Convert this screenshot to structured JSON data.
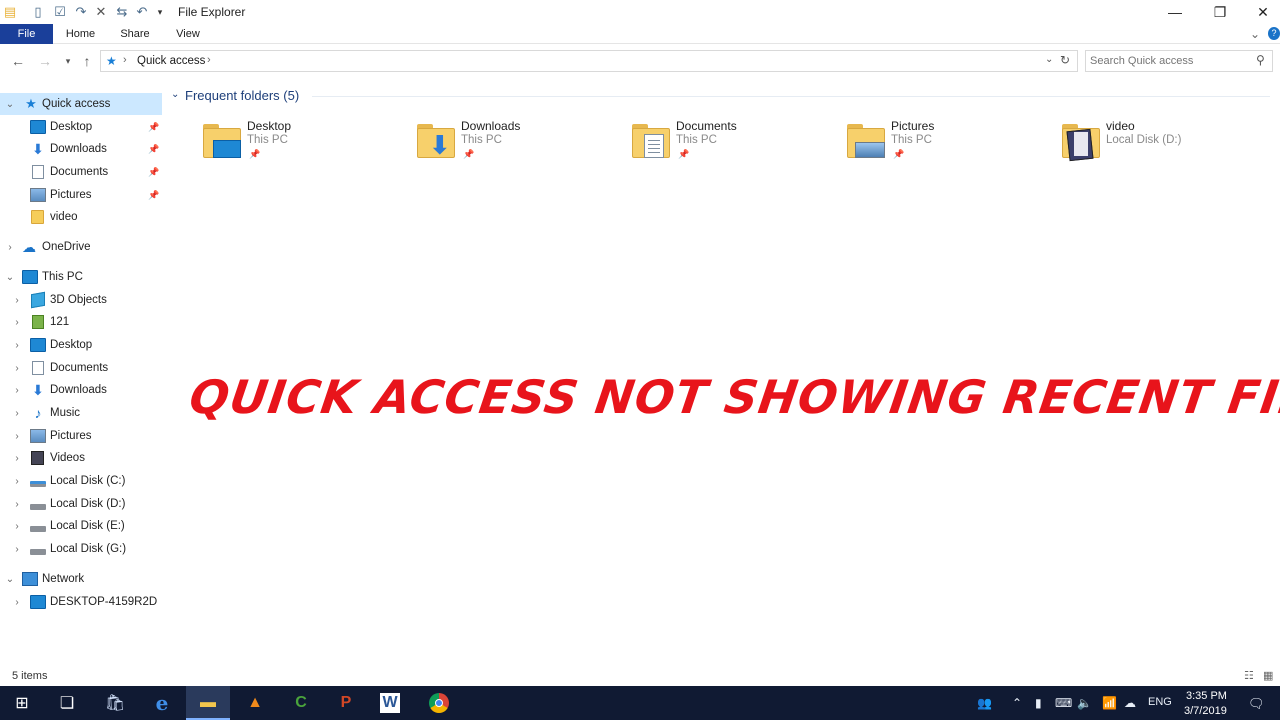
{
  "window": {
    "title": "File Explorer",
    "controls": {
      "minimize": "—",
      "restore": "❐",
      "close": "✕"
    }
  },
  "ribbon": {
    "tabs": [
      "File",
      "Home",
      "Share",
      "View"
    ],
    "expand_icon": "⌄",
    "help_icon": "?"
  },
  "address": {
    "path_icon": "quick-access-star",
    "path": "Quick access",
    "separator": "›",
    "search_placeholder": "Search Quick access"
  },
  "nav": {
    "quick_access": {
      "label": "Quick access",
      "items": [
        {
          "label": "Desktop",
          "icon": "desktop-icon",
          "pinned": true
        },
        {
          "label": "Downloads",
          "icon": "downloads-icon",
          "pinned": true
        },
        {
          "label": "Documents",
          "icon": "documents-icon",
          "pinned": true
        },
        {
          "label": "Pictures",
          "icon": "pictures-icon",
          "pinned": true
        },
        {
          "label": "video",
          "icon": "folder-icon",
          "pinned": false
        }
      ]
    },
    "onedrive": {
      "label": "OneDrive"
    },
    "this_pc": {
      "label": "This PC",
      "items": [
        {
          "label": "3D Objects",
          "icon": "3d-objects-icon"
        },
        {
          "label": "121",
          "icon": "image-file-icon"
        },
        {
          "label": "Desktop",
          "icon": "desktop-icon"
        },
        {
          "label": "Documents",
          "icon": "documents-icon"
        },
        {
          "label": "Downloads",
          "icon": "downloads-icon"
        },
        {
          "label": "Music",
          "icon": "music-icon"
        },
        {
          "label": "Pictures",
          "icon": "pictures-icon"
        },
        {
          "label": "Videos",
          "icon": "videos-icon"
        },
        {
          "label": "Local Disk (C:)",
          "icon": "system-drive-icon"
        },
        {
          "label": "Local Disk (D:)",
          "icon": "drive-icon"
        },
        {
          "label": "Local Disk (E:)",
          "icon": "drive-icon"
        },
        {
          "label": "Local Disk (G:)",
          "icon": "drive-icon"
        }
      ]
    },
    "network": {
      "label": "Network",
      "items": [
        {
          "label": "DESKTOP-4159R2D",
          "icon": "computer-icon"
        }
      ]
    }
  },
  "content": {
    "group_header": "Frequent folders (5)",
    "folders": [
      {
        "name": "Desktop",
        "location": "This PC",
        "pinned": true
      },
      {
        "name": "Downloads",
        "location": "This PC",
        "pinned": true
      },
      {
        "name": "Documents",
        "location": "This PC",
        "pinned": true
      },
      {
        "name": "Pictures",
        "location": "This PC",
        "pinned": true
      },
      {
        "name": "video",
        "location": "Local Disk (D:)",
        "pinned": false
      }
    ]
  },
  "caption": "QUICK ACCESS NOT SHOWING RECENT FILES",
  "status": {
    "item_count": "5 items"
  },
  "taskbar": {
    "apps": [
      "windows-start",
      "task-view",
      "store",
      "edge",
      "file-explorer",
      "vlc",
      "camtasia",
      "powerpoint",
      "word",
      "chrome"
    ],
    "tray": {
      "language": "ENG"
    },
    "clock": {
      "time": "3:35 PM",
      "date": "3/7/2019"
    }
  },
  "colors": {
    "file_tab": "#1a3f9a",
    "selected_nav": "#cce8ff",
    "caption": "#e8141b",
    "taskbar": "#101a33"
  }
}
